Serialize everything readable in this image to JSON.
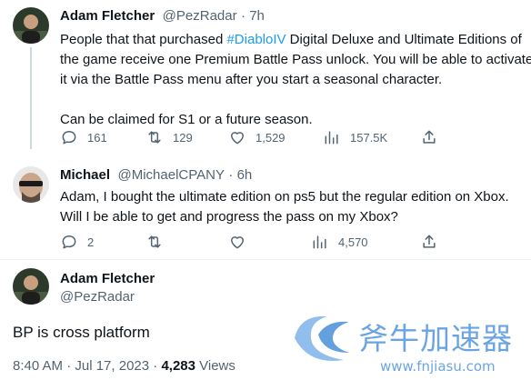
{
  "tweet1": {
    "name": "Adam Fletcher",
    "handle": "@PezRadar",
    "time": "7h",
    "text_l1_pre": "People that that purchased ",
    "hashtag": "#DiabloIV",
    "text_l1_post": " Digital Deluxe and Ultimate Editions of",
    "text_l2": "the game receive one Premium Battle Pass unlock. You will be able to activate",
    "text_l3": "it via the Battle Pass menu after you start a seasonal character.",
    "text_l5": "Can be claimed for S1 or a future season.",
    "replies": "161",
    "retweets": "129",
    "likes": "1,529",
    "views": "157.5K"
  },
  "tweet2": {
    "name": "Michael",
    "handle": "@MichaelCPANY",
    "time": "6h",
    "text_l1": "Adam, I bought the ultimate edition on ps5 but the regular edition on Xbox.",
    "text_l2": "Will I be able to get and progress the pass on my Xbox?",
    "replies": "2",
    "views": "4,570"
  },
  "tweet3": {
    "name": "Adam Fletcher",
    "handle": "@PezRadar",
    "text": "BP is cross platform",
    "timestamp": "8:40 AM · Jul 17, 2023 · ",
    "views_count": "4,283",
    "views_label": " Views"
  },
  "watermark": {
    "brand": "斧牛加速器",
    "url": "www.fnjiasu.com"
  },
  "colors": {
    "text": "#0f1419",
    "secondary": "#536471",
    "hashtag": "#1d9bf0",
    "watermark": "#4a8fd8"
  },
  "icons": [
    "reply-icon",
    "retweet-icon",
    "like-icon",
    "views-icon",
    "share-icon"
  ]
}
